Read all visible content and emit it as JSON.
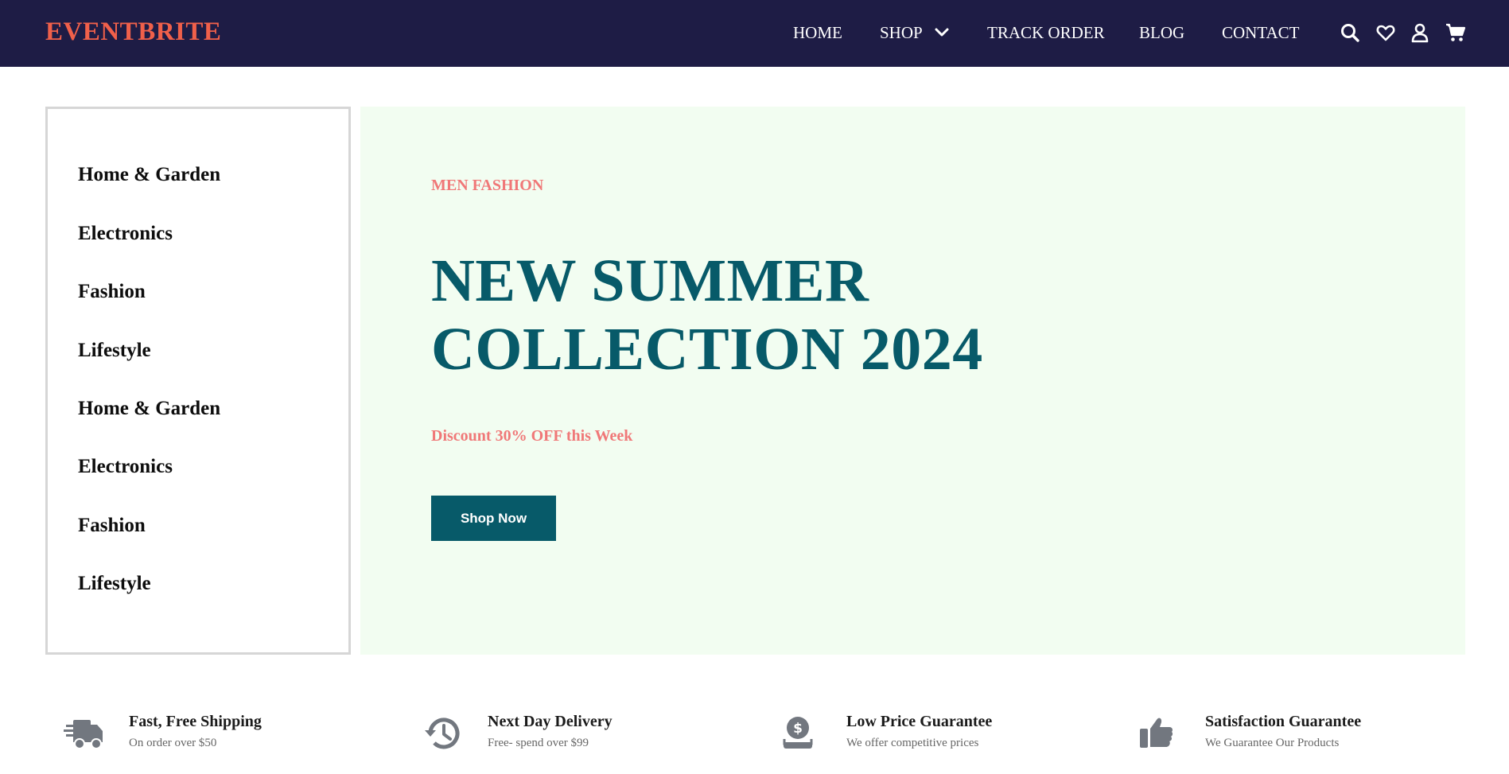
{
  "colors": {
    "header_bg": "#1e1c45",
    "logo": "#f0604a",
    "accent_teal": "#075a69",
    "accent_pink": "#f07878",
    "hero_bg": "#f2fdf1",
    "feature_icon": "#72777f"
  },
  "header": {
    "logo": "EVENTBRITE",
    "nav": {
      "home": "HOME",
      "shop": "SHOP",
      "track_order": "TRACK ORDER",
      "blog": "BLOG",
      "contact": "CONTACT"
    },
    "icons": [
      "search-icon",
      "heart-icon",
      "user-icon",
      "cart-icon"
    ]
  },
  "sidebar": {
    "categories": [
      "Home & Garden",
      "Electronics",
      "Fashion",
      "Lifestyle",
      "Home & Garden",
      "Electronics",
      "Fashion",
      "Lifestyle"
    ]
  },
  "hero": {
    "eyebrow": "MEN FASHION",
    "title_line1": "NEW SUMMER",
    "title_line2": "COLLECTION 2024",
    "discount": "Discount 30% OFF this Week",
    "button": "Shop Now"
  },
  "features": [
    {
      "icon": "truck-icon",
      "title": "Fast, Free Shipping",
      "subtitle": "On order over $50"
    },
    {
      "icon": "history-icon",
      "title": "Next Day Delivery",
      "subtitle": "Free- spend over $99"
    },
    {
      "icon": "money-hand-icon",
      "title": "Low Price Guarantee",
      "subtitle": "We offer competitive prices"
    },
    {
      "icon": "thumbs-up-icon",
      "title": "Satisfaction Guarantee",
      "subtitle": "We Guarantee Our Products"
    }
  ]
}
